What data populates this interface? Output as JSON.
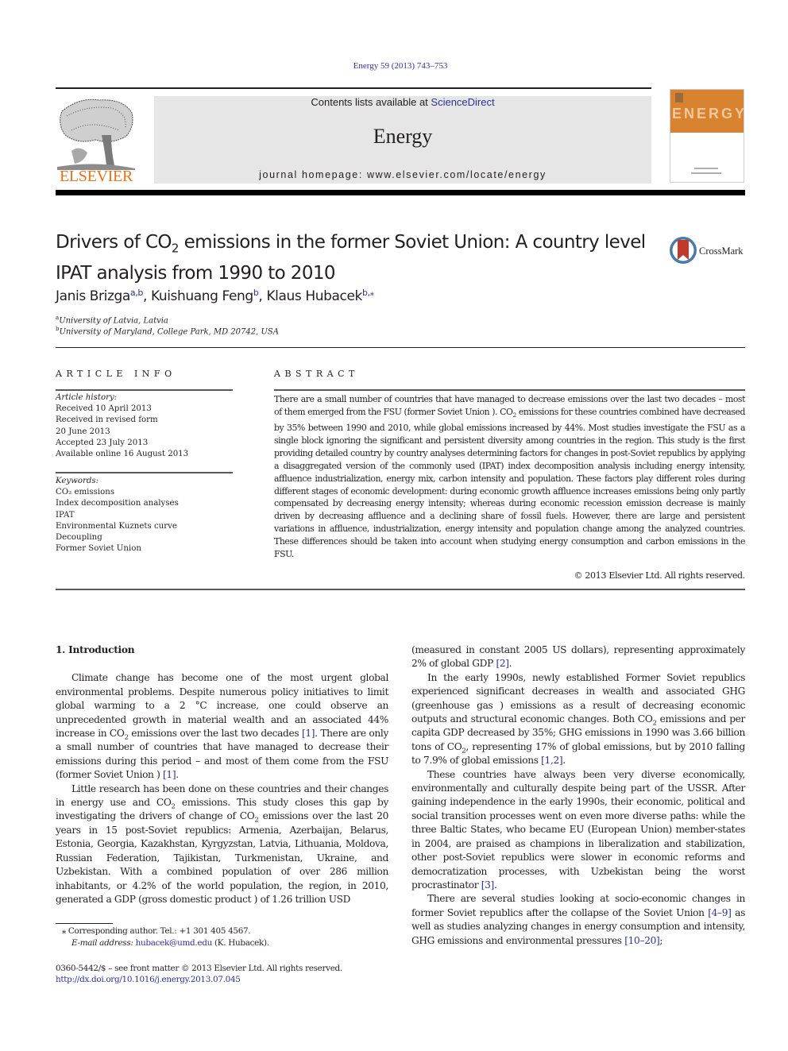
{
  "header": {
    "citation": "Energy 59 (2013) 743–753",
    "contents_prefix": "Contents lists available at ",
    "contents_link": "ScienceDirect",
    "journal_name": "Energy",
    "homepage_prefix": "journal homepage: ",
    "homepage_url": "www.elsevier.com/locate/energy",
    "publisher_logo_text": "ELSEVIER",
    "cover_title": "ENERGY",
    "publisher_color": "#e9711c",
    "cover_color": "#d7832f",
    "link_color": "#2e3192"
  },
  "article": {
    "title_part1": "Drivers of CO",
    "title_sub": "2",
    "title_part2": " emissions in the former Soviet Union: A country level IPAT analysis from 1990 to 2010",
    "crossmark_label": "CrossMark",
    "authors": [
      {
        "name": "Janis Brizga",
        "sup": "a,b"
      },
      {
        "name": "Kuishuang Feng",
        "sup": "b"
      },
      {
        "name": "Klaus Hubacek",
        "sup": "b,⁎"
      }
    ],
    "affiliations": [
      {
        "key": "a",
        "text": "University of Latvia, Latvia"
      },
      {
        "key": "b",
        "text": "University of Maryland, College Park, MD 20742, USA"
      }
    ]
  },
  "article_info": {
    "label": "ARTICLE INFO",
    "history_label": "Article history:",
    "history": [
      "Received 10 April 2013",
      "Received in revised form",
      "20 June 2013",
      "Accepted 23 July 2013",
      "Available online 16 August 2013"
    ],
    "keywords_label": "Keywords:",
    "keywords": [
      "CO₂ emissions",
      "Index decomposition analyses",
      "IPAT",
      "Environmental Kuznets curve",
      "Decoupling",
      "Former Soviet Union"
    ]
  },
  "abstract": {
    "label": "ABSTRACT",
    "text_1": "There are a small number of countries that have managed to decrease emissions over the last two decades – most of them emerged from the FSU (former Soviet Union ). CO",
    "text_2": " emissions for these countries combined have decreased by 35% between 1990 and 2010, while global emissions increased by 44%. Most studies investigate the FSU as a single block ignoring the significant and persistent diversity among countries in the region. This study is the first providing detailed country by country analyses determining factors for changes in post-Soviet republics by applying a disaggregated version of the commonly used (IPAT) index decomposition analysis including energy intensity, affluence industrialization, energy mix, carbon intensity and population. These factors play different roles during different stages of economic development: during economic growth affluence increases emissions being only partly compensated by decreasing energy intensity; whereas during economic recession emission decrease is mainly driven by decreasing affluence and a declining share of fossil fuels. However, there are large and persistent variations in affluence, industrialization, energy intensity and population change among the analyzed countries. These differences should be taken into account when studying energy consumption and carbon emissions in the FSU.",
    "copyright": "© 2013 Elsevier Ltd. All rights reserved."
  },
  "body": {
    "section_heading": "1.  Introduction",
    "p1": {
      "a": "Climate change has become one of the most urgent global environmental problems. Despite numerous policy initiatives to limit global warming to a 2 °C increase, one could observe an unprecedented growth in material wealth and an associated 44% increase in CO",
      "b": " emissions over the last two decades ",
      "ref1": "[1]",
      "c": ". There are only a small number of countries that have managed to decrease their emissions during this period – and most of them come from the FSU (former Soviet Union ) ",
      "ref2": "[1]",
      "d": "."
    },
    "p2": {
      "a": "Little research has been done on these countries and their changes in energy use and CO",
      "b": " emissions. This study closes this gap by investigating the drivers of change of CO",
      "c": " emissions over the last 20 years in 15 post-Soviet republics: Armenia, Azerbaijan, Belarus, Estonia, Georgia, Kazakhstan, Kyrgyzstan, Latvia, Lithuania, Moldova, Russian Federation, Tajikistan, Turkmenistan, Ukraine, and Uzbekistan. With a combined population of over 286 million inhabitants, or 4.2% of the world population, the region, in 2010, generated a GDP (gross domestic product ) of 1.26 trillion USD"
    },
    "p2_cont": {
      "a": "(measured in constant 2005 US dollars), representing approximately 2% of global GDP ",
      "ref": "[2]",
      "b": "."
    },
    "p3": {
      "a": "In the early 1990s, newly established Former Soviet republics experienced significant decreases in wealth and associated GHG (greenhouse gas ) emissions as a result of decreasing economic outputs and structural economic changes. Both CO",
      "b": " emissions and per capita GDP decreased by 35%; GHG emissions in 1990 was 3.66 billion tons of CO",
      "c": ", representing 17% of global emissions, but by 2010 falling to 7.9% of global emissions ",
      "ref": "[1,2]",
      "d": "."
    },
    "p4": {
      "a": "These countries have always been very diverse economically, environmentally and culturally despite being part of the USSR. After gaining independence in the early 1990s, their economic, political and social transition processes went on even more diverse paths: while the three Baltic States, who became EU (European Union) member-states in 2004, are praised as champions in liberalization and stabilization, other post-Soviet republics were slower in economic reforms and democratization processes, with Uzbekistan being the worst procrastinator ",
      "ref": "[3]",
      "b": "."
    },
    "p5": {
      "a": "There are several studies looking at socio-economic changes in former Soviet republics after the collapse of the Soviet Union ",
      "ref1": "[4–9]",
      "b": " as well as studies analyzing changes in energy consumption and intensity, GHG emissions and environmental pressures ",
      "ref2": "[10–20]",
      "c": ";"
    },
    "sub2": "2"
  },
  "footnotes": {
    "corresponding": "⁎  Corresponding author. Tel.: +1 301 405 4567.",
    "email_label": "E-mail address: ",
    "email": "hubacek@umd.edu",
    "email_suffix": " (K. Hubacek).",
    "front_matter": "0360-5442/$ – see front matter © 2013 Elsevier Ltd. All rights reserved.",
    "doi": "http://dx.doi.org/10.1016/j.energy.2013.07.045"
  }
}
